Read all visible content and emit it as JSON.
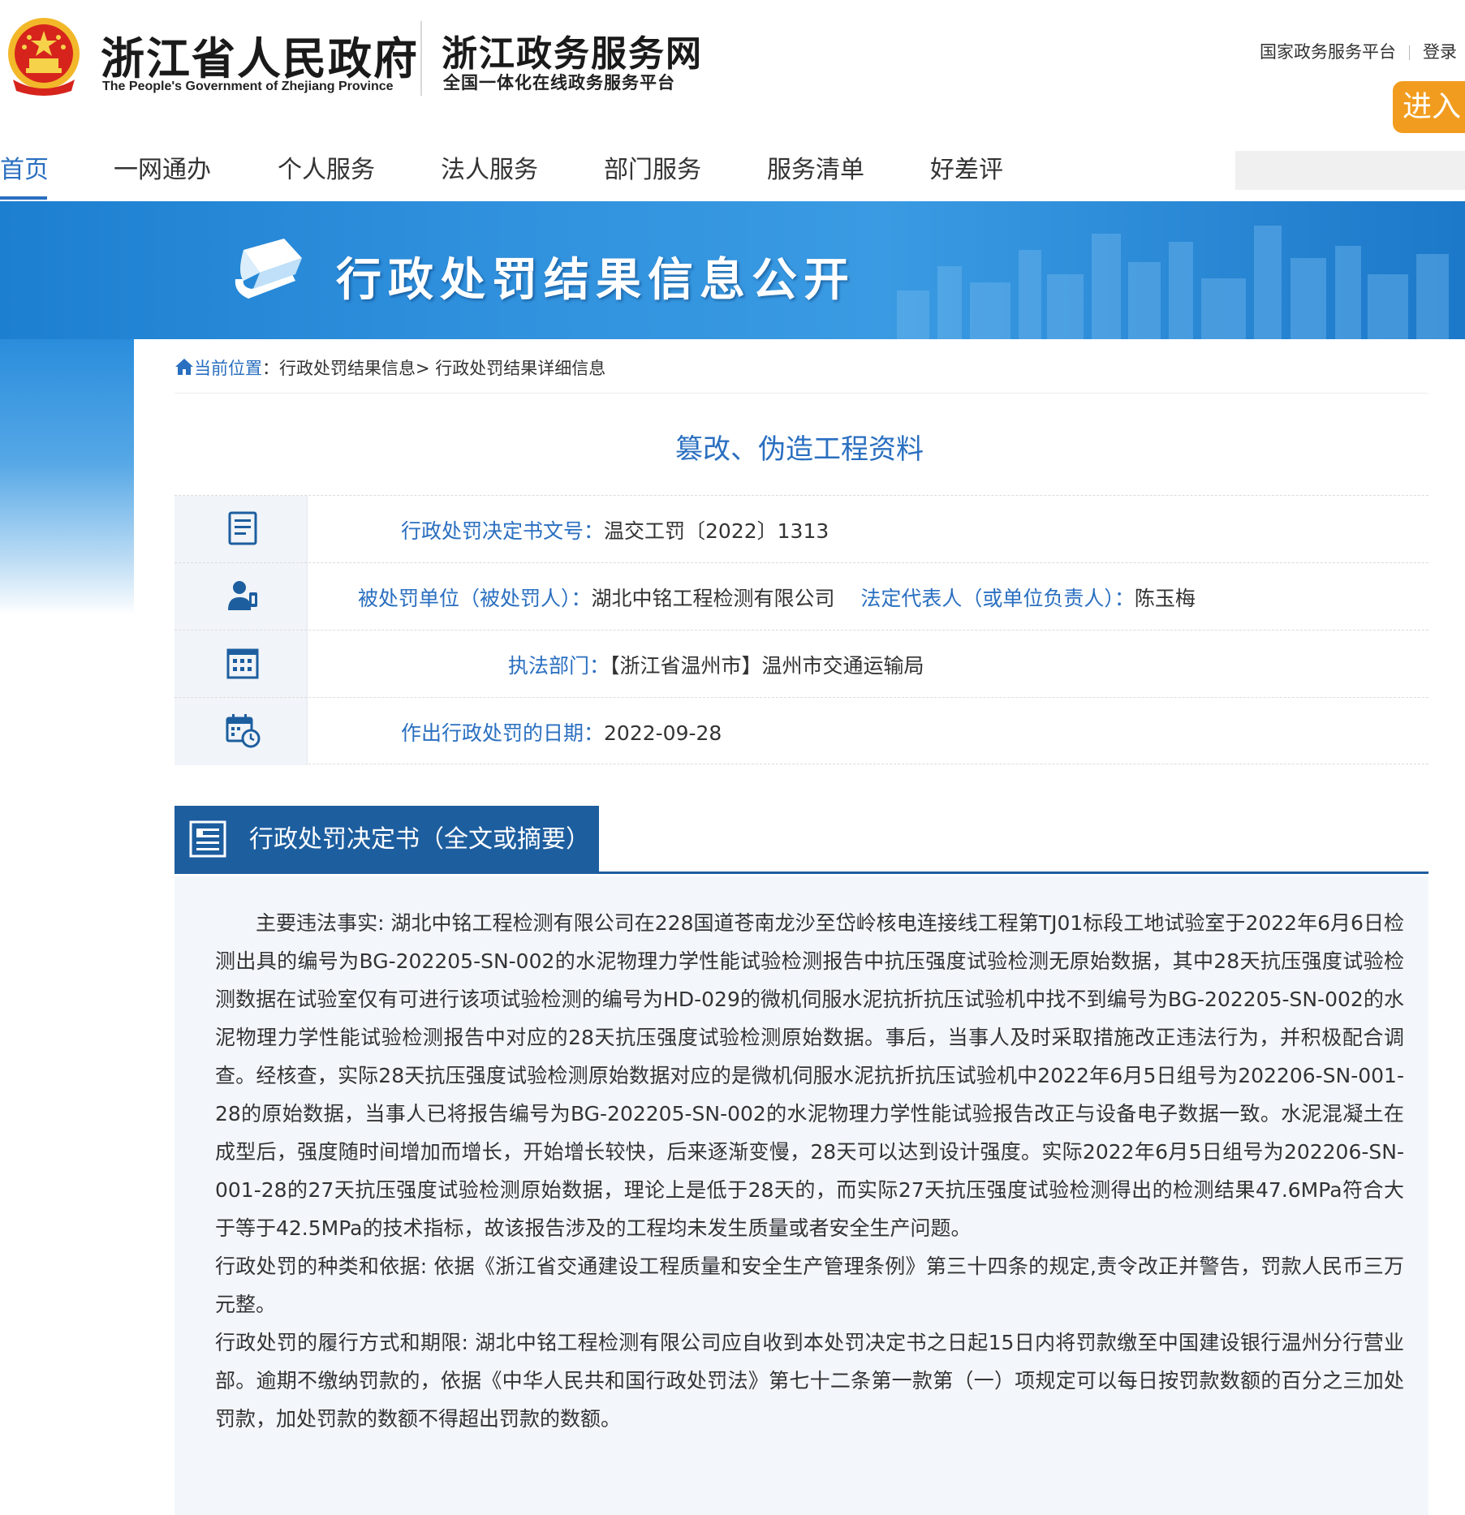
{
  "header": {
    "gov_title": "浙江省人民政府",
    "gov_subtitle": "The People's Government of Zhejiang Province",
    "service_title": "浙江政务服务网",
    "service_subtitle": "全国一体化在线政务服务平台",
    "link_national": "国家政务服务平台",
    "link_login": "登录",
    "enter_label": "进入"
  },
  "nav": {
    "items": [
      "首页",
      "一网通办",
      "个人服务",
      "法人服务",
      "部门服务",
      "服务清单",
      "好差评"
    ],
    "active": "首页"
  },
  "banner": {
    "title": "行政处罚结果信息公开"
  },
  "breadcrumb": {
    "home": "当前位置",
    "separator": "：",
    "level1": "行政处罚结果信息",
    "arrow": ">",
    "level2": "行政处罚结果详细信息"
  },
  "page_title": "篡改、伪造工程资料",
  "info": {
    "doc_no_label": "行政处罚决定书文号：",
    "doc_no_value": "温交工罚〔2022〕1313",
    "party_label": "被处罚单位（被处罚人）：",
    "party_value": "湖北中铭工程检测有限公司",
    "rep_label": "法定代表人（或单位负责人）：",
    "rep_value": "陈玉梅",
    "dept_label": "执法部门：",
    "dept_value": "【浙江省温州市】温州市交通运输局",
    "date_label": "作出行政处罚的日期：",
    "date_value": "2022-09-28"
  },
  "section": {
    "title": "行政处罚决定书（全文或摘要）"
  },
  "content": {
    "p1": "主要违法事实: 湖北中铭工程检测有限公司在228国道苍南龙沙至岱岭核电连接线工程第TJ01标段工地试验室于2022年6月6日检测出具的编号为BG-202205-SN-002的水泥物理力学性能试验检测报告中抗压强度试验检测无原始数据，其中28天抗压强度试验检测数据在试验室仅有可进行该项试验检测的编号为HD-029的微机伺服水泥抗折抗压试验机中找不到编号为BG-202205-SN-002的水泥物理力学性能试验检测报告中对应的28天抗压强度试验检测原始数据。事后，当事人及时采取措施改正违法行为，并积极配合调查。经核查，实际28天抗压强度试验检测原始数据对应的是微机伺服水泥抗折抗压试验机中2022年6月5日组号为202206-SN-001-28的原始数据，当事人已将报告编号为BG-202205-SN-002的水泥物理力学性能试验报告改正与设备电子数据一致。水泥混凝土在成型后，强度随时间增加而增长，开始增长较快，后来逐渐变慢，28天可以达到设计强度。实际2022年6月5日组号为202206-SN-001-28的27天抗压强度试验检测原始数据，理论上是低于28天的，而实际27天抗压强度试验检测得出的检测结果47.6MPa符合大于等于42.5MPa的技术指标，故该报告涉及的工程均未发生质量或者安全生产问题。",
    "p2": "行政处罚的种类和依据: 依据《浙江省交通建设工程质量和安全生产管理条例》第三十四条的规定,责令改正并警告，罚款人民币三万元整。",
    "p3": "行政处罚的履行方式和期限: 湖北中铭工程检测有限公司应自收到本处罚决定书之日起15日内将罚款缴至中国建设银行温州分行营业部。逾期不缴纳罚款的，依据《中华人民共和国行政处罚法》第七十二条第一款第（一）项规定可以每日按罚款数额的百分之三加处罚款，加处罚款的数额不得超出罚款的数额。"
  },
  "colors": {
    "accent": "#2a6fc0",
    "section_bg": "#1d5e9f",
    "enter_btn": "#f29c1f"
  },
  "icons": [
    "national-emblem-icon",
    "book-icon",
    "document-icon",
    "person-icon",
    "building-icon",
    "calendar-icon",
    "home-icon",
    "list-doc-icon"
  ]
}
